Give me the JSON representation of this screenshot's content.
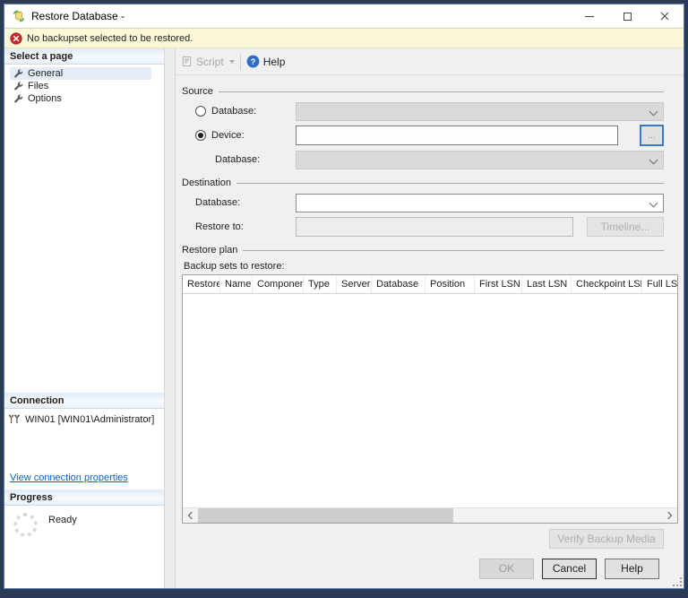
{
  "window": {
    "title": "Restore Database -",
    "controls": {
      "minimize": "minimize",
      "maximize": "maximize",
      "close": "close"
    }
  },
  "banner": {
    "text": "No backupset selected to be restored."
  },
  "sidebar": {
    "select_a_page": {
      "title": "Select a page",
      "items": [
        {
          "label": "General",
          "selected": true
        },
        {
          "label": "Files",
          "selected": false
        },
        {
          "label": "Options",
          "selected": false
        }
      ]
    },
    "connection": {
      "title": "Connection",
      "server": "WIN01 [WIN01\\Administrator]",
      "link": "View connection properties"
    },
    "progress": {
      "title": "Progress",
      "status": "Ready"
    }
  },
  "toolbar": {
    "script_label": "Script",
    "help_label": "Help"
  },
  "main": {
    "source": {
      "title": "Source",
      "database_label": "Database:",
      "database_value": "",
      "device_label": "Device:",
      "device_value": "",
      "browse_label": "...",
      "device_database_label": "Database:",
      "device_database_value": ""
    },
    "destination": {
      "title": "Destination",
      "database_label": "Database:",
      "database_value": "",
      "restore_to_label": "Restore to:",
      "restore_to_value": "",
      "timeline_label": "Timeline..."
    },
    "restore_plan": {
      "title": "Restore plan",
      "backup_sets_label": "Backup sets to restore:",
      "columns": [
        "Restore",
        "Name",
        "Component",
        "Type",
        "Server",
        "Database",
        "Position",
        "First LSN",
        "Last LSN",
        "Checkpoint LSN",
        "Full LSN"
      ],
      "rows": [],
      "verify_label": "Verify Backup Media"
    }
  },
  "footer": {
    "ok": "OK",
    "cancel": "Cancel",
    "help": "Help"
  },
  "colors": {
    "frame": "#2b3a55",
    "banner_bg": "#fbf8da",
    "error_red": "#cc2929",
    "link_blue": "#0a64c8",
    "focus_blue": "#3a79c8",
    "header_gradient_top": "#e0ebf6"
  }
}
